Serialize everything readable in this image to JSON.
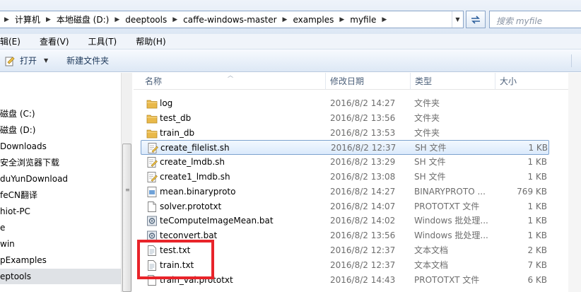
{
  "address": {
    "crumbs": [
      "计算机",
      "本地磁盘 (D:)",
      "deeptools",
      "caffe-windows-master",
      "examples",
      "myfile"
    ],
    "search_placeholder": "搜索 myfile"
  },
  "menu": [
    "辑(E)",
    "查看(V)",
    "工具(T)",
    "帮助(H)"
  ],
  "toolbar": {
    "open_label": "打开",
    "new_folder_label": "新建文件夹"
  },
  "nav": {
    "items": [
      {
        "label": "磁盘 (C:)",
        "selected": false
      },
      {
        "label": "磁盘 (D:)",
        "selected": false
      },
      {
        "label": "Downloads",
        "selected": false
      },
      {
        "label": "安全浏览器下载",
        "selected": false
      },
      {
        "label": "duYunDownload",
        "selected": false
      },
      {
        "label": "feCN翻译",
        "selected": false
      },
      {
        "label": "hiot-PC",
        "selected": false
      },
      {
        "label": "e",
        "selected": false
      },
      {
        "label": "win",
        "selected": false
      },
      {
        "label": "pExamples",
        "selected": false
      },
      {
        "label": "eptools",
        "selected": true
      }
    ]
  },
  "columns": {
    "name": "名称",
    "date": "修改日期",
    "type": "类型",
    "size": "大小"
  },
  "files": [
    {
      "name": "log",
      "date": "2016/8/2 14:27",
      "type": "文件夹",
      "size": "",
      "icon": "folder-icon",
      "selected": false
    },
    {
      "name": "test_db",
      "date": "2016/8/2 13:56",
      "type": "文件夹",
      "size": "",
      "icon": "folder-icon",
      "selected": false
    },
    {
      "name": "train_db",
      "date": "2016/8/2 13:53",
      "type": "文件夹",
      "size": "",
      "icon": "folder-icon",
      "selected": false
    },
    {
      "name": "create_filelist.sh",
      "date": "2016/8/2 12:37",
      "type": "SH 文件",
      "size": "1 KB",
      "icon": "script-file-icon",
      "selected": true
    },
    {
      "name": "create_lmdb.sh",
      "date": "2016/8/2 13:29",
      "type": "SH 文件",
      "size": "1 KB",
      "icon": "script-file-icon",
      "selected": false
    },
    {
      "name": "create1_lmdb.sh",
      "date": "2016/8/2 13:08",
      "type": "SH 文件",
      "size": "1 KB",
      "icon": "script-file-icon",
      "selected": false
    },
    {
      "name": "mean.binaryproto",
      "date": "2016/8/2 14:27",
      "type": "BINARYPROTO ...",
      "size": "769 KB",
      "icon": "binary-file-icon",
      "selected": false
    },
    {
      "name": "solver.prototxt",
      "date": "2016/8/2 14:07",
      "type": "PROTOTXT 文件",
      "size": "1 KB",
      "icon": "file-icon",
      "selected": false
    },
    {
      "name": "teComputeImageMean.bat",
      "date": "2016/8/2 14:02",
      "type": "Windows 批处理...",
      "size": "1 KB",
      "icon": "batch-file-icon",
      "selected": false
    },
    {
      "name": "teconvert.bat",
      "date": "2016/8/2 13:56",
      "type": "Windows 批处理...",
      "size": "1 KB",
      "icon": "batch-file-icon",
      "selected": false
    },
    {
      "name": "test.txt",
      "date": "2016/8/2 12:37",
      "type": "文本文档",
      "size": "2 KB",
      "icon": "text-file-icon",
      "selected": false
    },
    {
      "name": "train.txt",
      "date": "2016/8/2 12:37",
      "type": "文本文档",
      "size": "7 KB",
      "icon": "text-file-icon",
      "selected": false
    },
    {
      "name": "train_val.prototxt",
      "date": "2016/8/2 14:43",
      "type": "PROTOTXT 文件",
      "size": "6 KB",
      "icon": "file-icon",
      "selected": false
    }
  ],
  "colors": {
    "highlight": "#e8242a",
    "selection_border": "#7da2ce",
    "folder": "#e9b94a"
  }
}
